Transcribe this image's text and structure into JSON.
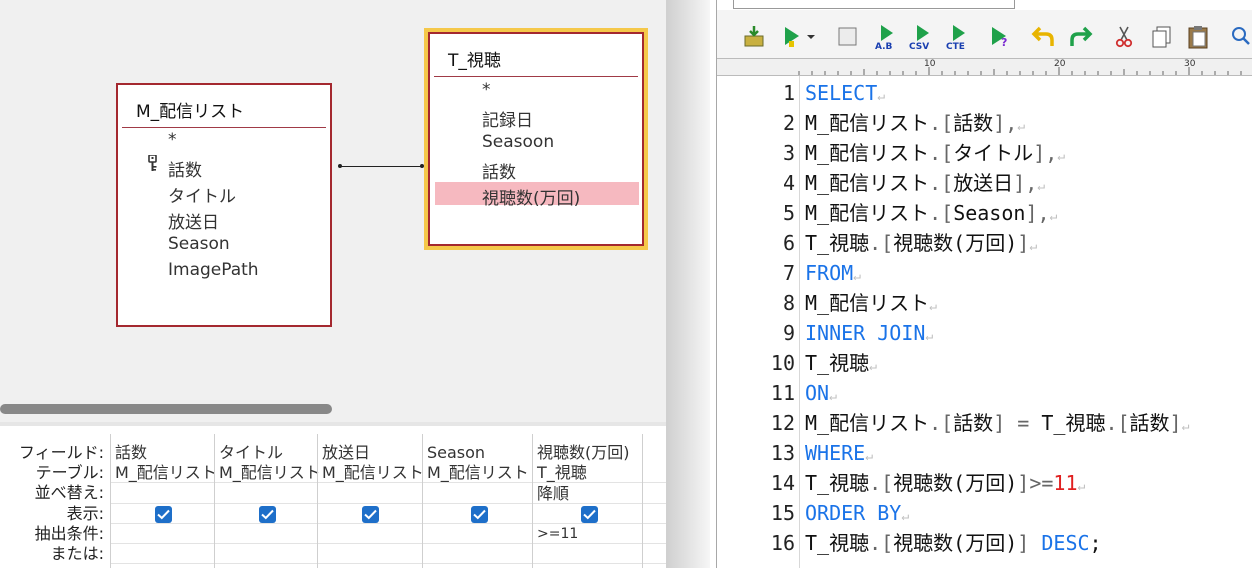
{
  "designer": {
    "tables": {
      "m": {
        "name": "M_配信リスト",
        "fields": [
          "*",
          "話数",
          "タイトル",
          "放送日",
          "Season",
          "ImagePath"
        ]
      },
      "t": {
        "name": "T_視聴",
        "fields": [
          "*",
          "記録日",
          "Seasoon",
          "話数",
          "視聴数(万回)"
        ]
      }
    },
    "grid": {
      "row_labels": [
        "フィールド:",
        "テーブル:",
        "並べ替え:",
        "表示:",
        "抽出条件:",
        "または:"
      ],
      "columns": [
        {
          "field": "話数",
          "table": "M_配信リスト",
          "sort": "",
          "show": true,
          "criteria": ""
        },
        {
          "field": "タイトル",
          "table": "M_配信リスト",
          "sort": "",
          "show": true,
          "criteria": ""
        },
        {
          "field": "放送日",
          "table": "M_配信リスト",
          "sort": "",
          "show": true,
          "criteria": ""
        },
        {
          "field": "Season",
          "table": "M_配信リスト",
          "sort": "",
          "show": true,
          "criteria": ""
        },
        {
          "field": "視聴数(万回)",
          "table": "T_視聴",
          "sort": "降順",
          "show": true,
          "criteria": ">=11"
        }
      ]
    }
  },
  "editor": {
    "ruler_marks": [
      "10",
      "20",
      "30"
    ],
    "eol_mark": "↵",
    "lines": [
      {
        "n": "1",
        "parts": [
          [
            "kw",
            "SELECT"
          ]
        ]
      },
      {
        "n": "2",
        "parts": [
          [
            "t",
            "M_配信リスト"
          ],
          [
            "br",
            ".["
          ],
          [
            "t",
            "話数"
          ],
          [
            "br",
            "],"
          ]
        ]
      },
      {
        "n": "3",
        "parts": [
          [
            "t",
            "M_配信リスト"
          ],
          [
            "br",
            ".["
          ],
          [
            "t",
            "タイトル"
          ],
          [
            "br",
            "],"
          ]
        ]
      },
      {
        "n": "4",
        "parts": [
          [
            "t",
            "M_配信リスト"
          ],
          [
            "br",
            ".["
          ],
          [
            "t",
            "放送日"
          ],
          [
            "br",
            "],"
          ]
        ]
      },
      {
        "n": "5",
        "parts": [
          [
            "t",
            "M_配信リスト"
          ],
          [
            "br",
            ".["
          ],
          [
            "t",
            "Season"
          ],
          [
            "br",
            "],"
          ]
        ]
      },
      {
        "n": "6",
        "parts": [
          [
            "t",
            "T_視聴"
          ],
          [
            "br",
            ".["
          ],
          [
            "t",
            "視聴数(万回)"
          ],
          [
            "br",
            "]"
          ]
        ]
      },
      {
        "n": "7",
        "parts": [
          [
            "kw",
            "FROM"
          ]
        ]
      },
      {
        "n": "8",
        "parts": [
          [
            "t",
            "M_配信リスト"
          ]
        ]
      },
      {
        "n": "9",
        "parts": [
          [
            "kw",
            "INNER JOIN"
          ]
        ]
      },
      {
        "n": "10",
        "parts": [
          [
            "t",
            "T_視聴"
          ]
        ]
      },
      {
        "n": "11",
        "parts": [
          [
            "kw",
            "ON"
          ]
        ]
      },
      {
        "n": "12",
        "parts": [
          [
            "t",
            "M_配信リスト"
          ],
          [
            "br",
            ".["
          ],
          [
            "t",
            "話数"
          ],
          [
            "br",
            "] = "
          ],
          [
            "t",
            "T_視聴"
          ],
          [
            "br",
            ".["
          ],
          [
            "t",
            "話数"
          ],
          [
            "br",
            "]"
          ]
        ]
      },
      {
        "n": "13",
        "parts": [
          [
            "kw",
            "WHERE"
          ]
        ]
      },
      {
        "n": "14",
        "parts": [
          [
            "t",
            "T_視聴"
          ],
          [
            "br",
            ".["
          ],
          [
            "t",
            "視聴数(万回)"
          ],
          [
            "br",
            "]>="
          ],
          [
            "num",
            "11"
          ]
        ]
      },
      {
        "n": "15",
        "parts": [
          [
            "kw",
            "ORDER BY"
          ]
        ]
      },
      {
        "n": "16",
        "parts": [
          [
            "t",
            "T_視聴"
          ],
          [
            "br",
            ".["
          ],
          [
            "t",
            "視聴数(万回)"
          ],
          [
            "br",
            "] "
          ],
          [
            "kw",
            "DESC"
          ],
          [
            "t",
            ";"
          ]
        ]
      }
    ]
  },
  "colors": {
    "keyword": "#1a73e8",
    "number": "#e02020",
    "table_border": "#a4282f",
    "selected_table": "#f5c84a",
    "highlight_field": "#f6b9c0",
    "checkbox": "#1e6fc9"
  }
}
